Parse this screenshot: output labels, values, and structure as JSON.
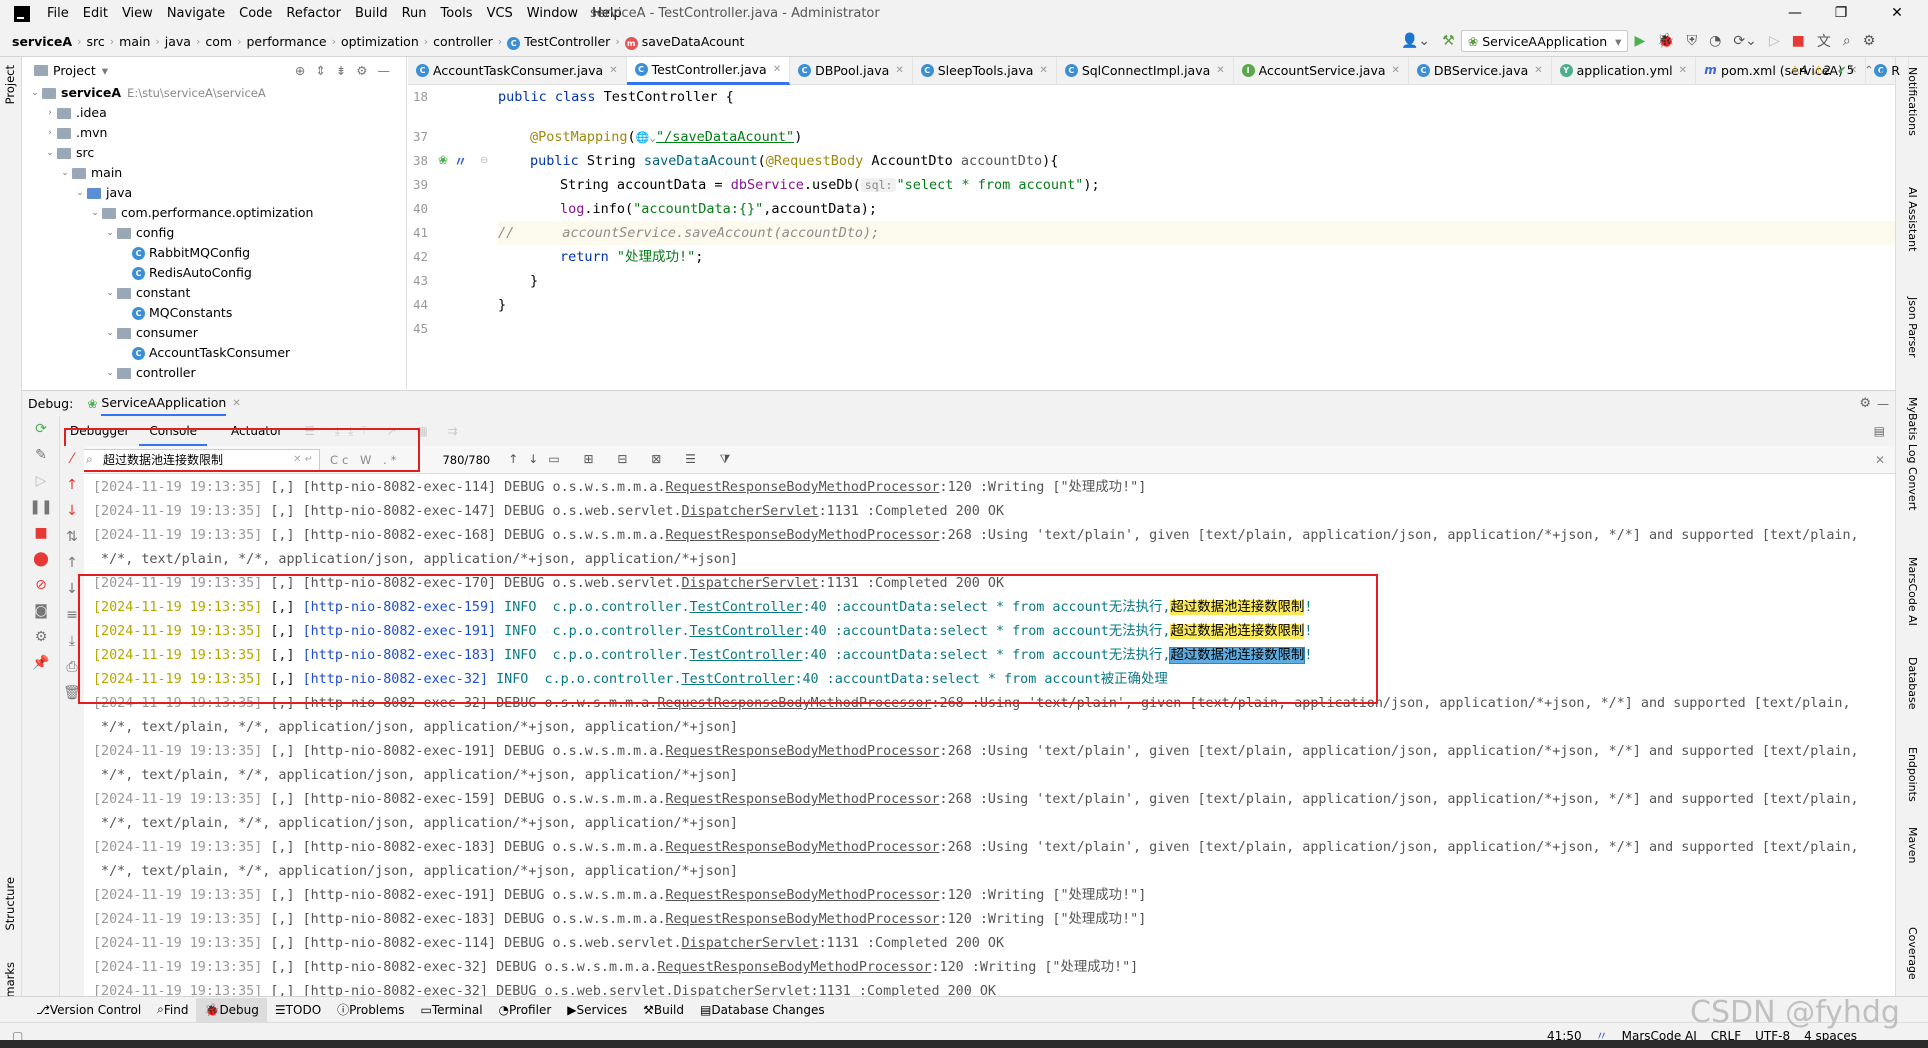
{
  "menu": {
    "items": [
      "File",
      "Edit",
      "View",
      "Navigate",
      "Code",
      "Refactor",
      "Build",
      "Run",
      "Tools",
      "VCS",
      "Window",
      "Help"
    ],
    "window_title": "serviceA - TestController.java - Administrator"
  },
  "breadcrumb": [
    "serviceA",
    "src",
    "main",
    "java",
    "com",
    "performance",
    "optimization",
    "controller",
    "TestController",
    "saveDataAcount"
  ],
  "run_config": "ServiceAApplication",
  "project": {
    "header": "Project",
    "root_name": "serviceA",
    "root_path": "E:\\stu\\serviceA\\serviceA",
    "items": [
      {
        "label": ".idea",
        "depth": 1,
        "arrow": "›",
        "type": "folder"
      },
      {
        "label": ".mvn",
        "depth": 1,
        "arrow": "›",
        "type": "folder"
      },
      {
        "label": "src",
        "depth": 1,
        "arrow": "⌄",
        "type": "folder"
      },
      {
        "label": "main",
        "depth": 2,
        "arrow": "⌄",
        "type": "folder"
      },
      {
        "label": "java",
        "depth": 3,
        "arrow": "⌄",
        "type": "folder-blue"
      },
      {
        "label": "com.performance.optimization",
        "depth": 4,
        "arrow": "⌄",
        "type": "folder"
      },
      {
        "label": "config",
        "depth": 5,
        "arrow": "⌄",
        "type": "folder"
      },
      {
        "label": "RabbitMQConfig",
        "depth": 6,
        "arrow": "",
        "type": "class"
      },
      {
        "label": "RedisAutoConfig",
        "depth": 6,
        "arrow": "",
        "type": "class"
      },
      {
        "label": "constant",
        "depth": 5,
        "arrow": "⌄",
        "type": "folder"
      },
      {
        "label": "MQConstants",
        "depth": 6,
        "arrow": "",
        "type": "class"
      },
      {
        "label": "consumer",
        "depth": 5,
        "arrow": "⌄",
        "type": "folder"
      },
      {
        "label": "AccountTaskConsumer",
        "depth": 6,
        "arrow": "",
        "type": "class"
      },
      {
        "label": "controller",
        "depth": 5,
        "arrow": "⌄",
        "type": "folder"
      }
    ]
  },
  "tabs": [
    {
      "label": "AccountTaskConsumer.java",
      "icon": "C",
      "active": false
    },
    {
      "label": "TestController.java",
      "icon": "C",
      "active": true
    },
    {
      "label": "DBPool.java",
      "icon": "C",
      "active": false
    },
    {
      "label": "SleepTools.java",
      "icon": "C",
      "active": false
    },
    {
      "label": "SqlConnectImpl.java",
      "icon": "C",
      "active": false
    },
    {
      "label": "AccountService.java",
      "icon": "I",
      "active": false
    },
    {
      "label": "DBService.java",
      "icon": "C",
      "active": false
    },
    {
      "label": "application.yml",
      "icon": "Y",
      "active": false
    },
    {
      "label": "pom.xml (serviceA)",
      "icon": "m",
      "active": false
    },
    {
      "label": "R",
      "icon": "C",
      "active": false
    }
  ],
  "inspections": {
    "warn1": "4",
    "warn2": "2",
    "ok": "5"
  },
  "code": {
    "line_numbers": [
      "18",
      "37",
      "38",
      "39",
      "40",
      "41",
      "42",
      "43",
      "44",
      "45"
    ],
    "l18_kw": "public class",
    "l18_rest": " TestController {",
    "l37_ann": "@PostMapping",
    "l37_open": "(",
    "l37_glob": "🌐⌄",
    "l37_url": "\"/saveDataAcount\"",
    "l37_close": ")",
    "l38_kw": "public",
    "l38_type": " String ",
    "l38_mth": "saveDataAcount",
    "l38_p1": "(",
    "l38_ann": "@RequestBody",
    "l38_p2": " AccountDto ",
    "l38_param": "accountDto",
    "l38_p3": "){",
    "l39_a": "String accountData = ",
    "l39_fld": "dbService",
    "l39_b": ".useDb(",
    "l39_hint": "sql:",
    "l39_str": "\"select * from account\"",
    "l39_c": ");",
    "l40_fld": "log",
    "l40_a": ".info(",
    "l40_str": "\"accountData:{}\"",
    "l40_b": ",accountData);",
    "l41_slashes": "//",
    "l41_cmt": "accountService.saveAccount(accountDto);",
    "l42_kw": "return",
    "l42_str": " \"处理成功!\"",
    "l42_end": ";",
    "l43": "}",
    "l44": "}"
  },
  "debug": {
    "label": "Debug:",
    "session": "ServiceAApplication",
    "tabs": [
      "Debugger",
      "Console",
      "Actuator"
    ],
    "search_value": "超过数据池连接数限制",
    "match_count": "780/780",
    "search_opts": [
      "Cc",
      "W",
      ".*"
    ]
  },
  "console_lines": [
    {
      "kind": "plain",
      "ts": "[2024-11-19 19:13:35]",
      "mid": " [,] [http-nio-8082-exec-114] DEBUG o.s.w.s.m.m.a.",
      "link": "RequestResponseBodyMethodProcessor",
      "tail": ":120 :Writing [\"处理成功!\"]"
    },
    {
      "kind": "plain",
      "ts": "[2024-11-19 19:13:35]",
      "mid": " [,] [http-nio-8082-exec-147] DEBUG o.s.web.servlet.",
      "link": "DispatcherServlet",
      "tail": ":1131 :Completed 200 OK"
    },
    {
      "kind": "plain",
      "ts": "[2024-11-19 19:13:35]",
      "mid": " [,] [http-nio-8082-exec-168] DEBUG o.s.w.s.m.m.a.",
      "link": "RequestResponseBodyMethodProcessor",
      "tail": ":268 :Using 'text/plain', given [text/plain, application/json, application/*+json, */*] and supported [text/plain,"
    },
    {
      "kind": "cont",
      "text": " */*, text/plain, */*, application/json, application/*+json, application/*+json]"
    },
    {
      "kind": "plain",
      "ts": "[2024-11-19 19:13:35]",
      "mid": " [,] [http-nio-8082-exec-170] DEBUG o.s.web.servlet.",
      "link": "DispatcherServlet",
      "tail": ":1131 :Completed 200 OK"
    },
    {
      "kind": "info",
      "ts": "[2024-11-19 19:13:35]",
      "thr": "[http-nio-8082-exec-159]",
      "pkg": "INFO  c.p.o.controller.",
      "link": "TestController",
      "msg": ":40 :accountData:select * from account无法执行,",
      "hl": "超过数据池连接数限制",
      "end": "!",
      "sel": false
    },
    {
      "kind": "info",
      "ts": "[2024-11-19 19:13:35]",
      "thr": "[http-nio-8082-exec-191]",
      "pkg": "INFO  c.p.o.controller.",
      "link": "TestController",
      "msg": ":40 :accountData:select * from account无法执行,",
      "hl": "超过数据池连接数限制",
      "end": "!",
      "sel": false
    },
    {
      "kind": "info",
      "ts": "[2024-11-19 19:13:35]",
      "thr": "[http-nio-8082-exec-183]",
      "pkg": "INFO  c.p.o.controller.",
      "link": "TestController",
      "msg": ":40 :accountData:select * from account无法执行,",
      "hl": "超过数据池连接数限制",
      "end": "!",
      "sel": true
    },
    {
      "kind": "info",
      "ts": "[2024-11-19 19:13:35]",
      "thr": "[http-nio-8082-exec-32]",
      "pkg": "INFO  c.p.o.controller.",
      "link": "TestController",
      "msg": ":40 :accountData:select * from account被正确处理",
      "hl": "",
      "end": "",
      "sel": false
    },
    {
      "kind": "plain",
      "ts": "[2024-11-19 19:13:35]",
      "mid": " [,] [http-nio-8082-exec-32] DEBUG o.s.w.s.m.m.a.",
      "link": "RequestResponseBodyMethodProcessor",
      "tail": ":268 :Using 'text/plain', given [text/plain, application/json, application/*+json, */*] and supported [text/plain,"
    },
    {
      "kind": "cont",
      "text": " */*, text/plain, */*, application/json, application/*+json, application/*+json]"
    },
    {
      "kind": "plain",
      "ts": "[2024-11-19 19:13:35]",
      "mid": " [,] [http-nio-8082-exec-191] DEBUG o.s.w.s.m.m.a.",
      "link": "RequestResponseBodyMethodProcessor",
      "tail": ":268 :Using 'text/plain', given [text/plain, application/json, application/*+json, */*] and supported [text/plain,"
    },
    {
      "kind": "cont",
      "text": " */*, text/plain, */*, application/json, application/*+json, application/*+json]"
    },
    {
      "kind": "plain",
      "ts": "[2024-11-19 19:13:35]",
      "mid": " [,] [http-nio-8082-exec-159] DEBUG o.s.w.s.m.m.a.",
      "link": "RequestResponseBodyMethodProcessor",
      "tail": ":268 :Using 'text/plain', given [text/plain, application/json, application/*+json, */*] and supported [text/plain,"
    },
    {
      "kind": "cont",
      "text": " */*, text/plain, */*, application/json, application/*+json, application/*+json]"
    },
    {
      "kind": "plain",
      "ts": "[2024-11-19 19:13:35]",
      "mid": " [,] [http-nio-8082-exec-183] DEBUG o.s.w.s.m.m.a.",
      "link": "RequestResponseBodyMethodProcessor",
      "tail": ":268 :Using 'text/plain', given [text/plain, application/json, application/*+json, */*] and supported [text/plain,"
    },
    {
      "kind": "cont",
      "text": " */*, text/plain, */*, application/json, application/*+json, application/*+json]"
    },
    {
      "kind": "plain",
      "ts": "[2024-11-19 19:13:35]",
      "mid": " [,] [http-nio-8082-exec-191] DEBUG o.s.w.s.m.m.a.",
      "link": "RequestResponseBodyMethodProcessor",
      "tail": ":120 :Writing [\"处理成功!\"]"
    },
    {
      "kind": "plain",
      "ts": "[2024-11-19 19:13:35]",
      "mid": " [,] [http-nio-8082-exec-183] DEBUG o.s.w.s.m.m.a.",
      "link": "RequestResponseBodyMethodProcessor",
      "tail": ":120 :Writing [\"处理成功!\"]"
    },
    {
      "kind": "plain",
      "ts": "[2024-11-19 19:13:35]",
      "mid": " [,] [http-nio-8082-exec-114] DEBUG o.s.web.servlet.",
      "link": "DispatcherServlet",
      "tail": ":1131 :Completed 200 OK"
    },
    {
      "kind": "plain",
      "ts": "[2024-11-19 19:13:35]",
      "mid": " [,] [http-nio-8082-exec-32] DEBUG o.s.w.s.m.m.a.",
      "link": "RequestResponseBodyMethodProcessor",
      "tail": ":120 :Writing [\"处理成功!\"]"
    },
    {
      "kind": "plain",
      "ts": "[2024-11-19 19:13:35]",
      "mid": " [,] [http-nio-8082-exec-32] DEBUG o.s.web.servlet.",
      "link": "DispatcherServlet",
      "tail": ":1131 :Completed 200 OK"
    }
  ],
  "left_strip": [
    "Project",
    "Structure",
    "Bookmarks"
  ],
  "right_strip": [
    "Notifications",
    "AI Assistant",
    "Json Parser",
    "MyBatis Log Convert",
    "MarsCode AI",
    "Database",
    "Endpoints",
    "Maven",
    "Coverage"
  ],
  "status_tabs": [
    "Version Control",
    "Find",
    "Debug",
    "TODO",
    "Problems",
    "Terminal",
    "Profiler",
    "Services",
    "Build",
    "Database Changes"
  ],
  "status_right": {
    "position": "41:50",
    "marscode": "MarsCode AI",
    "crlf": "CRLF",
    "encoding": "UTF-8",
    "indent": "4 spaces"
  },
  "watermark": "CSDN @fyhdg"
}
